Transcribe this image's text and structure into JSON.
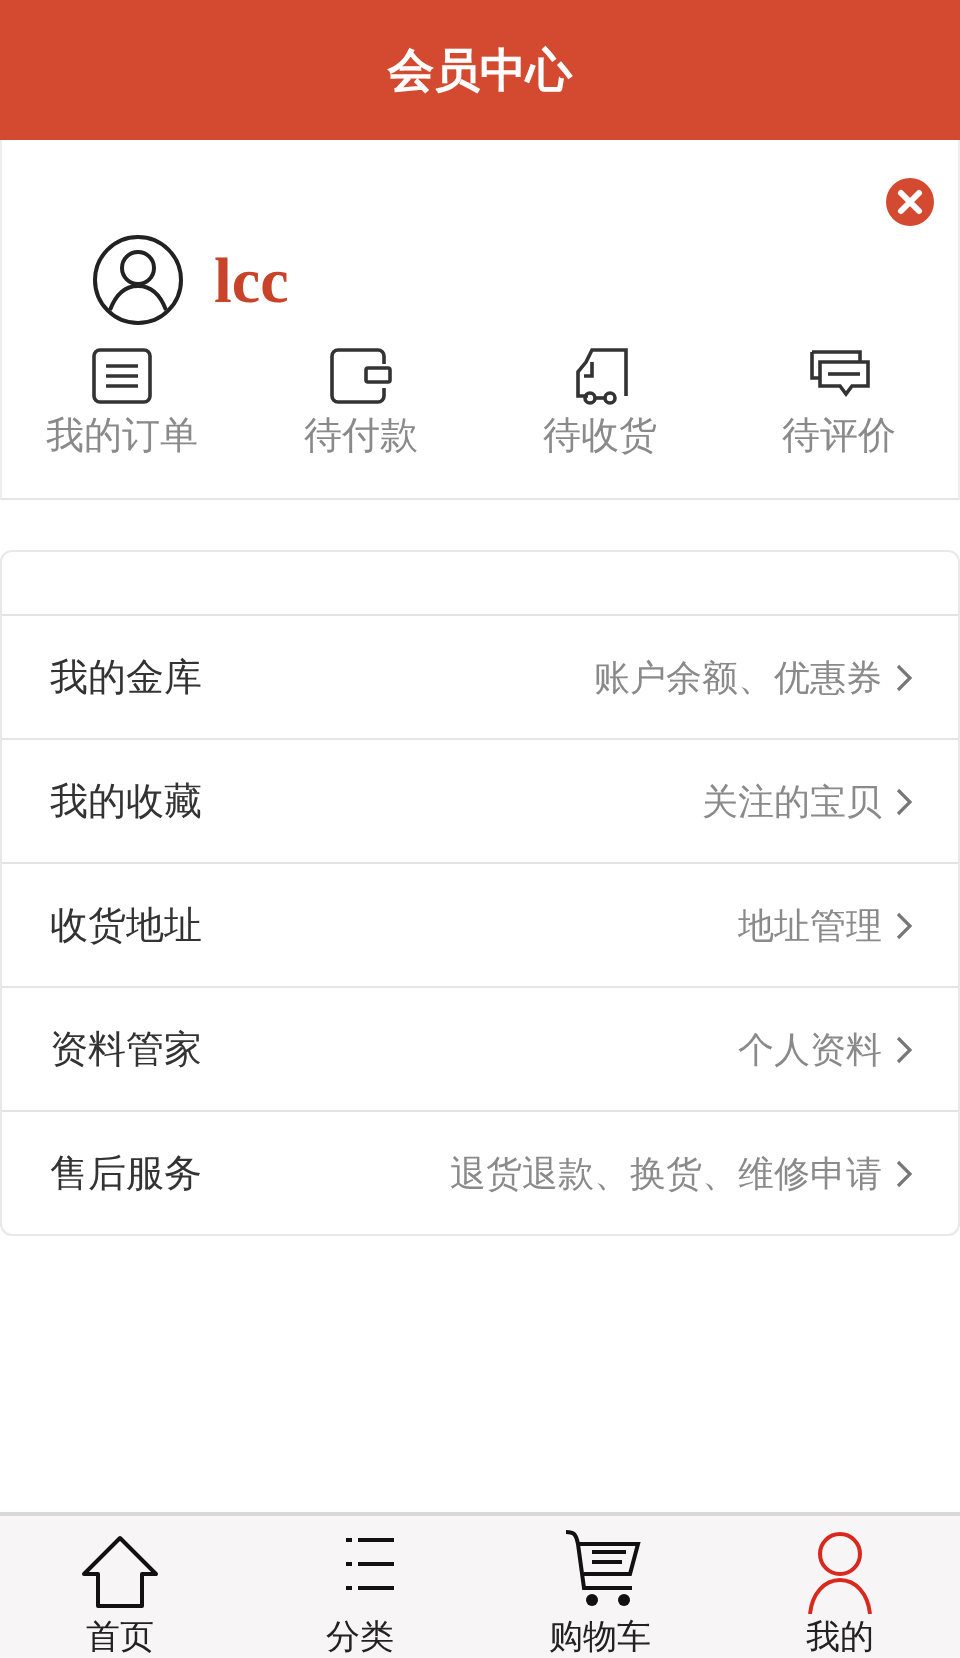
{
  "header": {
    "title": "会员中心"
  },
  "profile": {
    "username": "lcc"
  },
  "order_shortcuts": [
    {
      "kind": "list",
      "label": "我的订单"
    },
    {
      "kind": "wallet",
      "label": "待付款"
    },
    {
      "kind": "truck",
      "label": "待收货"
    },
    {
      "kind": "chat",
      "label": "待评价"
    }
  ],
  "menu": [
    {
      "label": "我的金库",
      "detail": "账户余额、优惠券"
    },
    {
      "label": "我的收藏",
      "detail": "关注的宝贝"
    },
    {
      "label": "收货地址",
      "detail": "地址管理"
    },
    {
      "label": "资料管家",
      "detail": "个人资料"
    },
    {
      "label": "售后服务",
      "detail": "退货退款、换货、维修申请"
    }
  ],
  "tab_bar": [
    {
      "kind": "home",
      "label": "首页",
      "selected": false
    },
    {
      "kind": "category",
      "label": "分类",
      "selected": false
    },
    {
      "kind": "cart",
      "label": "购物车",
      "selected": false
    },
    {
      "kind": "user",
      "label": "我的",
      "selected": true
    }
  ]
}
